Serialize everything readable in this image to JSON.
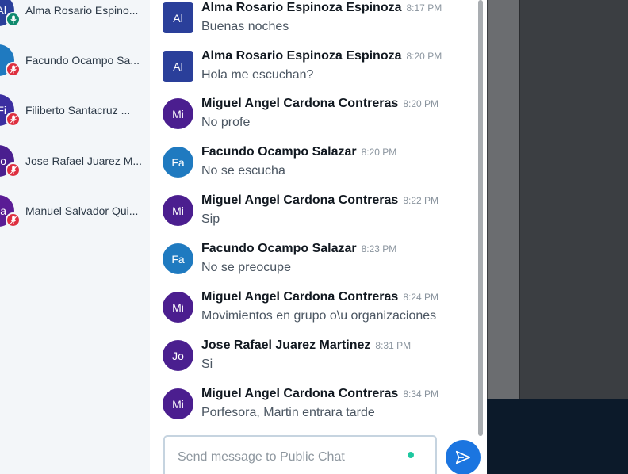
{
  "users": [
    {
      "name": "Alma Rosario Espino...",
      "avatar": "Al",
      "color": "#2a3f9a",
      "badge": "mic-icon",
      "badge_color": "#0f8a6e"
    },
    {
      "name": "Facundo Ocampo Sa...",
      "avatar": "",
      "color": "#1f7ac0",
      "badge": "mic-muted-icon",
      "badge_color": "#de2f3f"
    },
    {
      "name": "Filiberto Santacruz ...",
      "avatar": "Fi",
      "color": "#3b2ea0",
      "badge": "mic-muted-icon",
      "badge_color": "#de2f3f"
    },
    {
      "name": "Jose Rafael Juarez M...",
      "avatar": "Jo",
      "color": "#4a1f8f",
      "badge": "mic-muted-icon",
      "badge_color": "#de2f3f"
    },
    {
      "name": "Manuel Salvador Qui...",
      "avatar": "Ma",
      "color": "#5a1c95",
      "badge": "mic-muted-icon",
      "badge_color": "#de2f3f"
    }
  ],
  "messages": [
    {
      "avatar": "Al",
      "color": "#2a3f9a",
      "square": true,
      "author": "Alma Rosario Espinoza Espinoza",
      "time": "8:17 PM",
      "text": "Buenas noches"
    },
    {
      "avatar": "Al",
      "color": "#2a3f9a",
      "square": true,
      "author": "Alma Rosario Espinoza Espinoza",
      "time": "8:20 PM",
      "text": "Hola me escuchan?"
    },
    {
      "avatar": "Mi",
      "color": "#4b1e8f",
      "square": false,
      "author": "Miguel Angel Cardona Contreras",
      "time": "8:20 PM",
      "text": "No profe"
    },
    {
      "avatar": "Fa",
      "color": "#1f7ac0",
      "square": false,
      "author": "Facundo Ocampo Salazar",
      "time": "8:20 PM",
      "text": "No se escucha"
    },
    {
      "avatar": "Mi",
      "color": "#4b1e8f",
      "square": false,
      "author": "Miguel Angel Cardona Contreras",
      "time": "8:22 PM",
      "text": "Sip"
    },
    {
      "avatar": "Fa",
      "color": "#1f7ac0",
      "square": false,
      "author": "Facundo Ocampo Salazar",
      "time": "8:23 PM",
      "text": "No se preocupe"
    },
    {
      "avatar": "Mi",
      "color": "#4b1e8f",
      "square": false,
      "author": "Miguel Angel Cardona Contreras",
      "time": "8:24 PM",
      "text": "Movimientos en grupo o\\u organizaciones"
    },
    {
      "avatar": "Jo",
      "color": "#4a1f8f",
      "square": false,
      "author": "Jose Rafael Juarez Martinez",
      "time": "8:31 PM",
      "text": "Si"
    },
    {
      "avatar": "Mi",
      "color": "#4b1e8f",
      "square": false,
      "author": "Miguel Angel Cardona Contreras",
      "time": "8:34 PM",
      "text": "Porfesora, Martin entrara tarde"
    }
  ],
  "composer": {
    "placeholder": "Send message to Public Chat",
    "value": ""
  },
  "send_icon": "send-icon"
}
